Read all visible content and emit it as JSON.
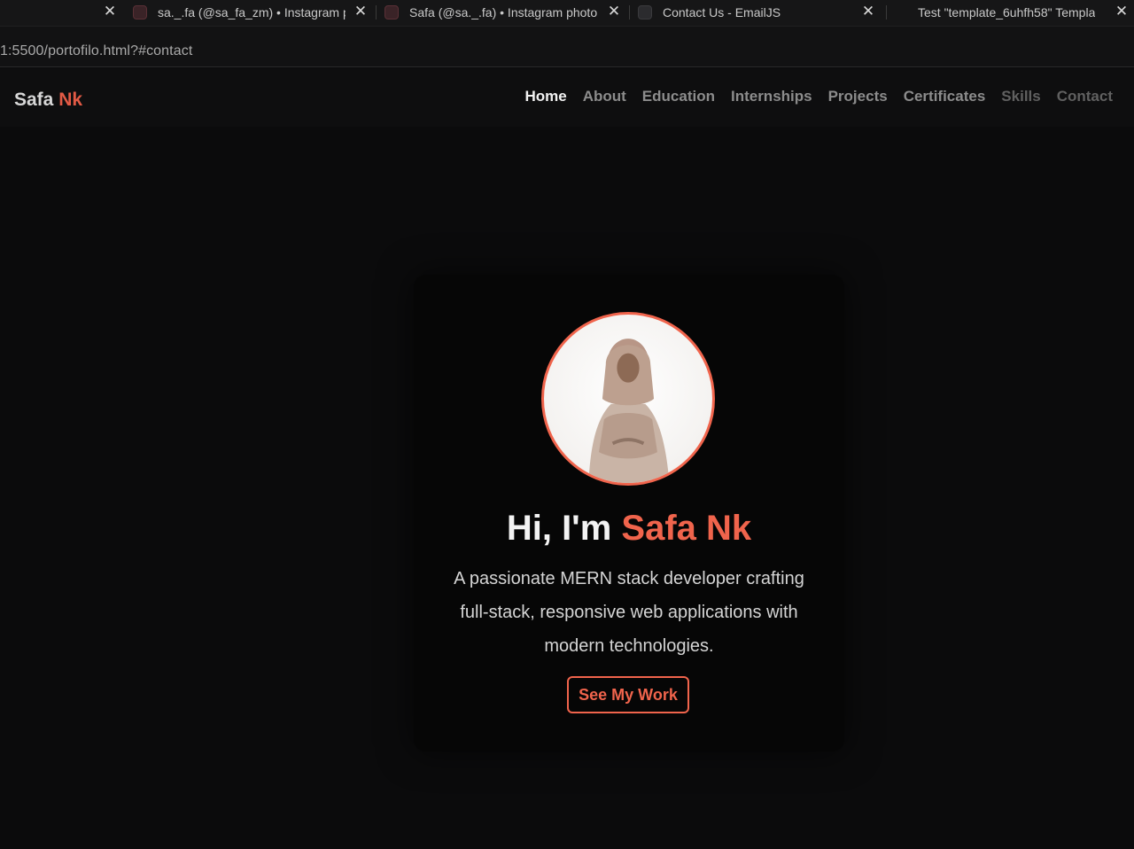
{
  "browser": {
    "tabs": [
      {
        "title": "sa._.fa (@sa_fa_zm) • Instagram p",
        "icon": "instagram-icon"
      },
      {
        "title": "Safa (@sa._.fa) • Instagram photo",
        "icon": "instagram-icon"
      },
      {
        "title": "Contact Us - EmailJS",
        "icon": "emailjs-icon"
      },
      {
        "title": "Test \"template_6uhfh58\" Templa",
        "icon": "emailjs-icon"
      }
    ],
    "close_glyph": "✕",
    "url": "1:5500/portofilo.html?#contact"
  },
  "site": {
    "brand": {
      "first": "Safa",
      "accent": "Nk"
    },
    "nav": [
      "Home",
      "About",
      "Education",
      "Internships",
      "Projects",
      "Certificates",
      "Skills",
      "Contact"
    ],
    "active_nav": "Home",
    "hero": {
      "greeting": "Hi, I'm",
      "name": "Safa Nk",
      "subtitle": "A passionate MERN stack developer crafting full-stack, responsive web applications with modern technologies.",
      "cta_label": "See My Work"
    }
  },
  "colors": {
    "accent": "#f0644c",
    "background": "#0b0b0c",
    "card": "#060606"
  }
}
